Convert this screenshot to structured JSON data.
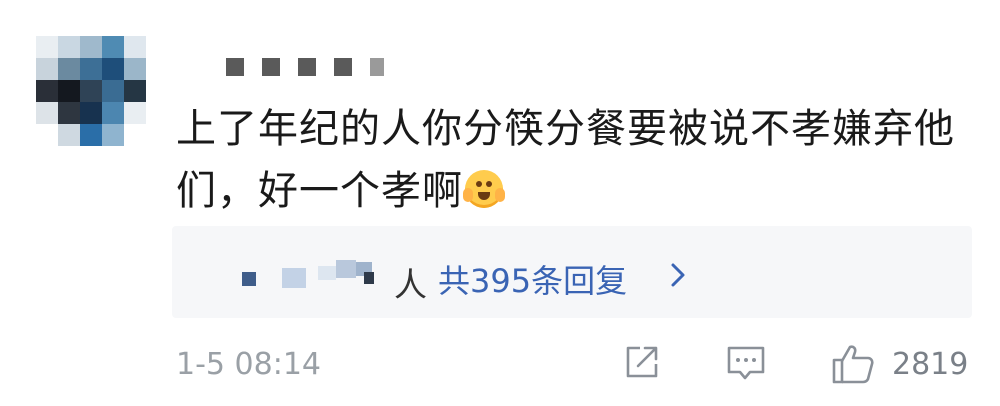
{
  "comment": {
    "username_masked": "■■■■■",
    "text_line1": "上了年纪的人你分筷分餐要被说不孝嫌弃他",
    "text_line2": "们，好一个孝啊",
    "emoji": "smiling-face-with-open-hands-emoji"
  },
  "replies": {
    "person_suffix": "人",
    "count_label": "共395条回复",
    "chevron": "chevron-right-icon"
  },
  "footer": {
    "timestamp": "1-5 08:14",
    "share_icon": "share-icon",
    "comment_icon": "comment-icon",
    "like_icon": "thumbs-up-icon",
    "like_count": "2819"
  }
}
